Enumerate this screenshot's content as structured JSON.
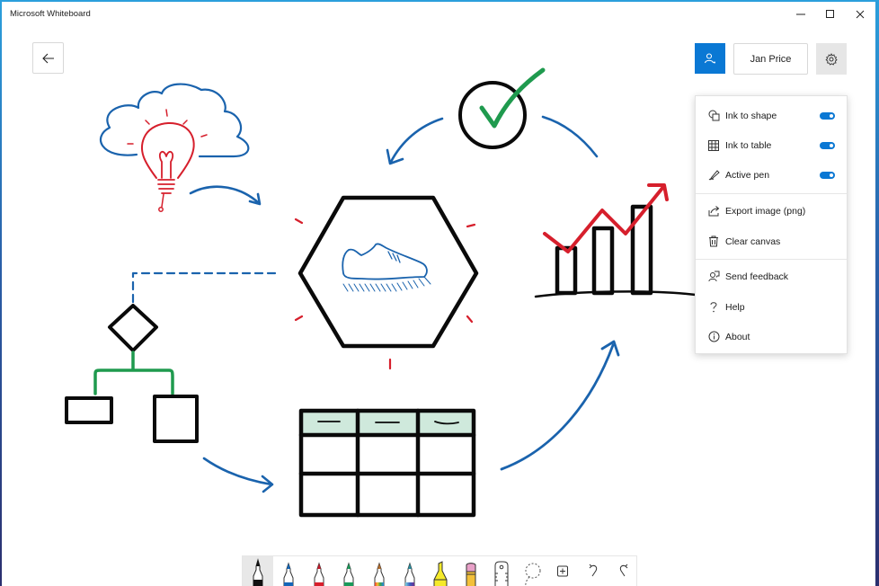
{
  "window": {
    "title": "Microsoft Whiteboard",
    "controls": [
      "minimize",
      "maximize",
      "close"
    ]
  },
  "header": {
    "back_label": "Back",
    "share_icon": "person-add-icon",
    "user_name": "Jan Price",
    "settings_icon": "gear-icon"
  },
  "settings_menu": {
    "toggles": [
      {
        "label": "Ink to shape",
        "icon": "ink-to-shape-icon",
        "on": true
      },
      {
        "label": "Ink to table",
        "icon": "table-grid-icon",
        "on": true
      },
      {
        "label": "Active pen",
        "icon": "pen-icon",
        "on": true
      }
    ],
    "actions": [
      {
        "label": "Export image (png)",
        "icon": "share-export-icon"
      },
      {
        "label": "Clear canvas",
        "icon": "trash-icon"
      }
    ],
    "info": [
      {
        "label": "Send feedback",
        "icon": "feedback-icon"
      },
      {
        "label": "Help",
        "icon": "question-icon"
      },
      {
        "label": "About",
        "icon": "info-icon"
      }
    ]
  },
  "toolbar": {
    "tools": [
      {
        "name": "black-pen",
        "color": "#111111",
        "selected": true
      },
      {
        "name": "blue-pen",
        "color": "#1466b8",
        "selected": false
      },
      {
        "name": "red-pen",
        "color": "#d81e2c",
        "selected": false
      },
      {
        "name": "green-pen",
        "color": "#1a9a5a",
        "selected": false
      },
      {
        "name": "rainbow-pen",
        "color": "rainbow",
        "selected": false
      },
      {
        "name": "galaxy-pen",
        "color": "galaxy",
        "selected": false
      },
      {
        "name": "highlighter",
        "color": "#f5ea2a",
        "selected": false
      },
      {
        "name": "eraser",
        "color": "#e8a0c8",
        "selected": false
      },
      {
        "name": "ruler",
        "color": "",
        "selected": false
      },
      {
        "name": "lasso-select",
        "color": "",
        "selected": false
      },
      {
        "name": "add-content",
        "color": "",
        "selected": false
      },
      {
        "name": "undo",
        "color": "",
        "selected": false
      },
      {
        "name": "redo",
        "color": "",
        "selected": false
      }
    ]
  },
  "canvas": {
    "ink_colors": {
      "blue": "#1a63ad",
      "red": "#d61f2c",
      "green": "#1f9a4e",
      "black": "#0a0a0a",
      "table_header_fill": "#cfe9dc"
    },
    "drawings": [
      "cloud-lightbulb",
      "check-circle",
      "hexagon-shoe",
      "bar-chart-trend",
      "flowchart",
      "table",
      "arrows"
    ]
  },
  "colors": {
    "accent": "#0a78d4",
    "settings_bg": "#e6e6e6"
  }
}
